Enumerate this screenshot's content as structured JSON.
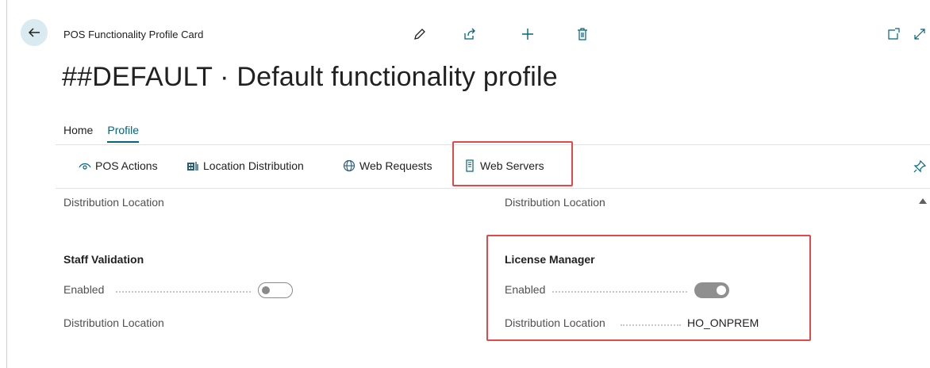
{
  "header": {
    "card_title": "POS Functionality Profile Card",
    "page_title": "##DEFAULT · Default functionality profile"
  },
  "toolbar": {
    "edit_icon": "pencil-icon",
    "share_icon": "share-icon",
    "new_icon": "plus-icon",
    "delete_icon": "trash-icon",
    "open_new_icon": "open-new-window-icon",
    "expand_icon": "expand-icon"
  },
  "tabs": [
    {
      "label": "Home",
      "active": false
    },
    {
      "label": "Profile",
      "active": true
    }
  ],
  "actions": [
    {
      "label": "POS Actions",
      "icon": "eye-icon"
    },
    {
      "label": "Location Distribution",
      "icon": "location-distribution-icon"
    },
    {
      "label": "Web Requests",
      "icon": "globe-icon"
    },
    {
      "label": "Web Servers",
      "icon": "server-icon"
    }
  ],
  "sections": {
    "left_top_label": "Distribution Location",
    "right_top_label": "Distribution Location",
    "staff_validation": {
      "title": "Staff Validation",
      "enabled_label": "Enabled",
      "enabled": false,
      "distribution_label": "Distribution Location",
      "distribution_value": ""
    },
    "license_manager": {
      "title": "License Manager",
      "enabled_label": "Enabled",
      "enabled": true,
      "distribution_label": "Distribution Location",
      "distribution_value": "HO_ONPREM"
    }
  },
  "colors": {
    "accent": "#00657f",
    "highlight": "#e04a4a",
    "back_button_bg": "#d9eaf1"
  }
}
